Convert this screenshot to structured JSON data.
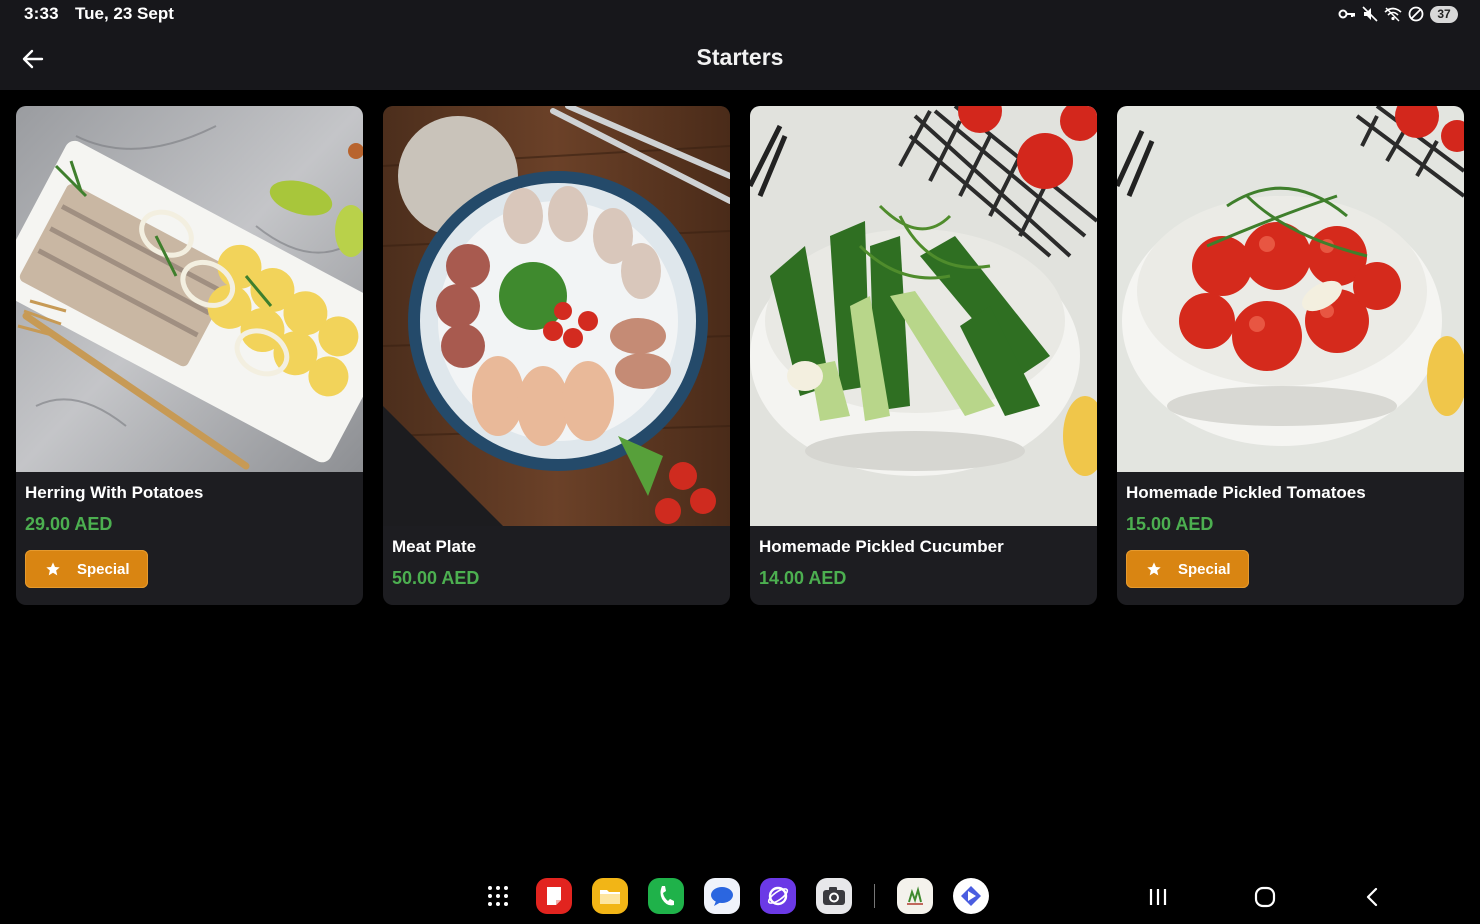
{
  "status_bar": {
    "time": "3:33",
    "date": "Tue, 23 Sept",
    "battery": "37",
    "icons": [
      "key-icon",
      "mute-icon",
      "wifi-icon",
      "do-not-disturb-icon",
      "battery-icon"
    ]
  },
  "app_bar": {
    "title": "Starters",
    "back_icon": "arrow-left-icon"
  },
  "items": [
    {
      "name": "Herring With Potatoes",
      "price": "29.00 AED",
      "badge": "Special"
    },
    {
      "name": "Meat Plate",
      "price": "50.00 AED"
    },
    {
      "name": "Homemade Pickled Cucumber",
      "price": "14.00 AED"
    },
    {
      "name": "Homemade Pickled Tomatoes",
      "price": "15.00 AED",
      "badge": "Special"
    }
  ],
  "dock": {
    "apps": [
      "app-drawer-icon",
      "notes-icon",
      "files-icon",
      "phone-icon",
      "messages-icon",
      "internet-icon",
      "camera-icon",
      "restaurant-app-icon",
      "play-store-icon"
    ]
  },
  "nav": [
    "recents-icon",
    "home-icon",
    "back-nav-icon"
  ],
  "colors": {
    "background": "#000000",
    "surface": "#1d1d21",
    "price_green": "#4caf50",
    "badge_orange": "#d98512"
  }
}
